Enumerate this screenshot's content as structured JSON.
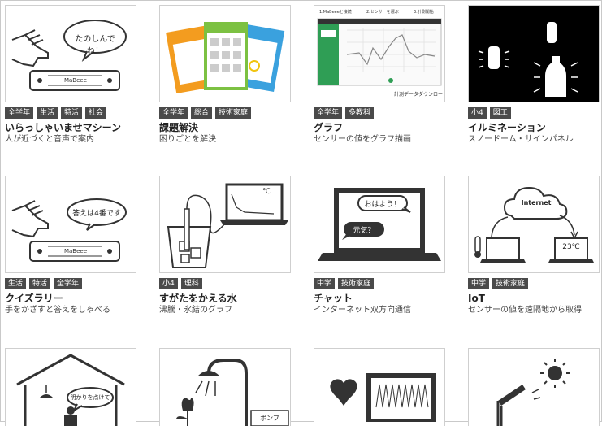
{
  "cards": [
    {
      "tags": [
        "全学年",
        "生活",
        "特活",
        "社会"
      ],
      "title": "いらっしゃいませマシーン",
      "desc": "人が近づくと音声で案内",
      "bubble": "たのしんでね！",
      "device": "MaBeee"
    },
    {
      "tags": [
        "全学年",
        "総合",
        "技術家庭"
      ],
      "title": "課題解決",
      "desc": "困りごとを解決"
    },
    {
      "tags": [
        "全学年",
        "多教科"
      ],
      "title": "グラフ",
      "desc": "センサーの値をグラフ描画",
      "steps": [
        "1.MaBeeeと接続",
        "2.センサーを選ぶ",
        "3.計測開始"
      ],
      "download": "計測データダウンロード"
    },
    {
      "tags": [
        "小4",
        "図工"
      ],
      "title": "イルミネーション",
      "desc": "スノードーム・サインパネル"
    },
    {
      "tags": [
        "生活",
        "特活",
        "全学年"
      ],
      "title": "クイズラリー",
      "desc": "手をかざすと答えをしゃべる",
      "bubble": "答えは4番です",
      "device": "MaBeee"
    },
    {
      "tags": [
        "小4",
        "理科"
      ],
      "title": "すがたをかえる水",
      "desc": "沸騰・氷結のグラフ",
      "unit": "℃"
    },
    {
      "tags": [
        "中学",
        "技術家庭"
      ],
      "title": "チャット",
      "desc": "インターネット双方向通信",
      "bubble1": "おはよう！",
      "bubble2": "元気？"
    },
    {
      "tags": [
        "中学",
        "技術家庭"
      ],
      "title": "IoT",
      "desc": "センサーの値を遠隔地から取得",
      "cloud": "Internet",
      "temp": "23℃"
    },
    {
      "tags": [],
      "title": "",
      "desc": "",
      "bubble": "明かりを点けて"
    },
    {
      "tags": [],
      "title": "",
      "desc": "",
      "label": "ポンプ"
    },
    {
      "tags": [],
      "title": "",
      "desc": ""
    },
    {
      "tags": [],
      "title": "",
      "desc": ""
    }
  ]
}
